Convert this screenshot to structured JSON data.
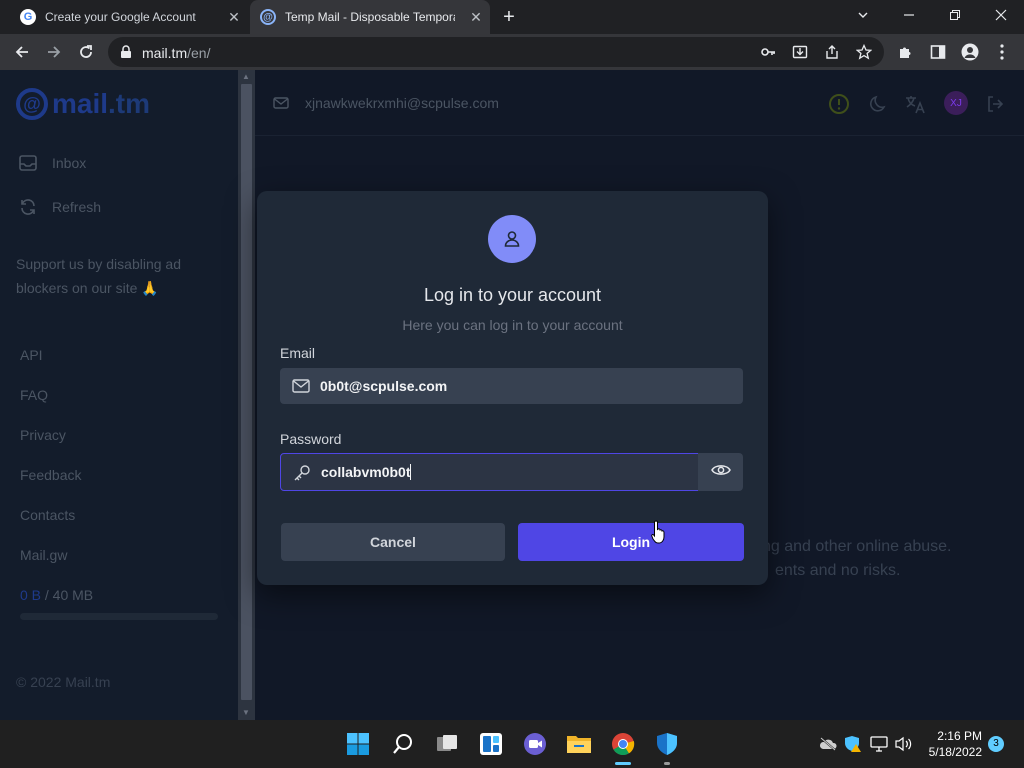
{
  "browser": {
    "tabs": [
      {
        "title": "Create your Google Account",
        "favicon": "google-g-icon"
      },
      {
        "title": "Temp Mail - Disposable Temporary",
        "favicon": "mailtm-at-icon",
        "active": true
      }
    ],
    "url_host": "mail.tm",
    "url_path": "/en/"
  },
  "sidebar": {
    "logo_text": "mail",
    "logo_suffix": ".tm",
    "nav": [
      {
        "label": "Inbox",
        "icon": "inbox-icon"
      },
      {
        "label": "Refresh",
        "icon": "refresh-icon"
      }
    ],
    "support_text": "Support us by disabling ad blockers on our site 🙏",
    "links": [
      "API",
      "FAQ",
      "Privacy",
      "Feedback",
      "Contacts",
      "Mail.gw"
    ],
    "quota_used": "0 B",
    "quota_total": " / 40 MB",
    "quota_fraction": 0,
    "copyright": "© 2022 Mail.tm"
  },
  "topbar": {
    "email": "xjnawkwekrxmhi@scpulse.com",
    "avatar_initials": "XJ"
  },
  "background_text": {
    "line1": "ng and other online abuse.",
    "line2": "ents and no risks."
  },
  "modal": {
    "title": "Log in to your account",
    "subtitle": "Here you can log in to your account",
    "email_label": "Email",
    "email_value": "0b0t@scpulse.com",
    "password_label": "Password",
    "password_value": "collabvm0b0t",
    "cancel_label": "Cancel",
    "login_label": "Login"
  },
  "taskbar": {
    "time": "2:16 PM",
    "date": "5/18/2022",
    "notification_count": "3"
  },
  "colors": {
    "accent": "#4f46e5",
    "avatar": "#818cf8",
    "modal_bg": "#1f2937",
    "page_bg": "#111827"
  }
}
